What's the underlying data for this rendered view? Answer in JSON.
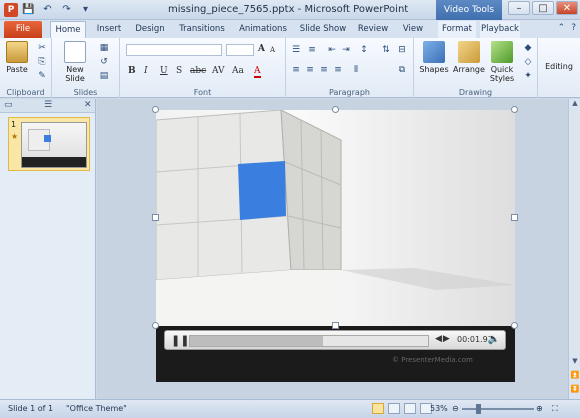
{
  "window": {
    "title": "missing_piece_7565.pptx - Microsoft PowerPoint",
    "context_tab_group": "Video Tools",
    "app_letter": "P"
  },
  "tabs": [
    "File",
    "Home",
    "Insert",
    "Design",
    "Transitions",
    "Animations",
    "Slide Show",
    "Review",
    "View",
    "Format",
    "Playback"
  ],
  "ribbon": {
    "clipboard": {
      "label": "Clipboard",
      "paste": "Paste"
    },
    "slides": {
      "label": "Slides",
      "new_slide": "New Slide"
    },
    "font": {
      "label": "Font",
      "bold": "B",
      "italic": "I",
      "underline": "U",
      "shadow": "S",
      "strike": "abc",
      "spacing": "AV",
      "case": "Aa",
      "color": "A",
      "grow": "A",
      "shrink": "A"
    },
    "paragraph": {
      "label": "Paragraph"
    },
    "drawing": {
      "label": "Drawing",
      "shapes": "Shapes",
      "arrange": "Arrange",
      "quick_styles": "Quick Styles"
    },
    "editing": {
      "label": "Editing"
    }
  },
  "slides_pane": {
    "slide_number": "1",
    "thumbnail_caption_icon": "star-icon"
  },
  "video": {
    "elapsed": "00:01.97",
    "progress_fraction": 0.56,
    "watermark": "© PresenterMedia.com"
  },
  "status": {
    "slide_info": "Slide 1 of 1",
    "theme": "\"Office Theme\"",
    "zoom": "53%"
  },
  "colors": {
    "accent": "#3a7fe0",
    "file_tab": "#d24726",
    "context_tab": "#4a7bbd"
  }
}
